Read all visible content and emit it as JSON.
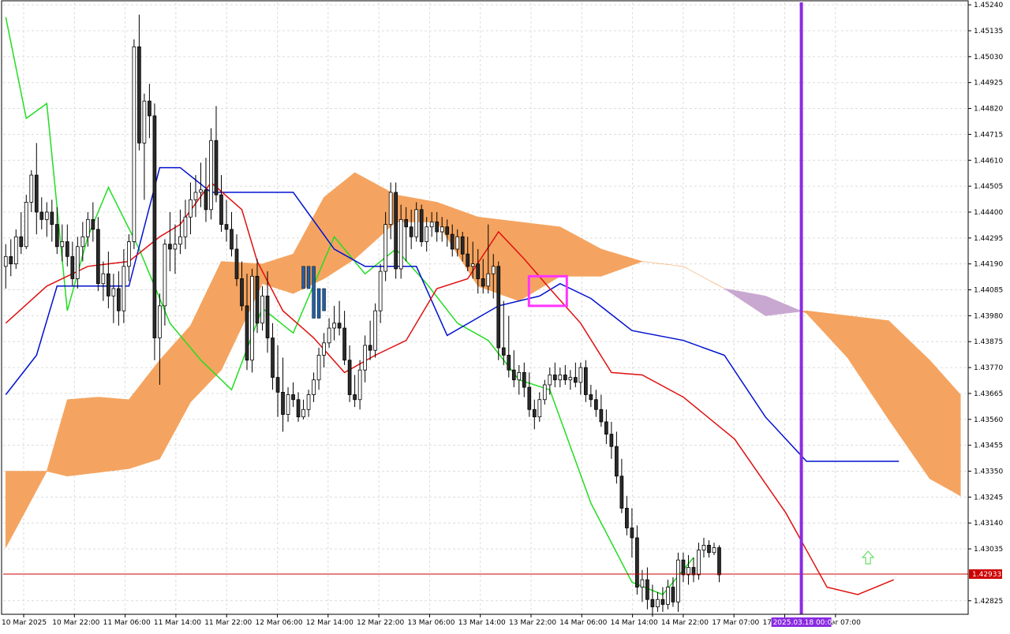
{
  "chart_data": {
    "type": "candlestick",
    "instrument_note": "",
    "y_ticks": [
      "1.45240",
      "1.45135",
      "1.45030",
      "1.44925",
      "1.44820",
      "1.44715",
      "1.44610",
      "1.44505",
      "1.44400",
      "1.44295",
      "1.44190",
      "1.44085",
      "1.43980",
      "1.43875",
      "1.43770",
      "1.43665",
      "1.43560",
      "1.43455",
      "1.43350",
      "1.43245",
      "1.43140",
      "1.43035",
      "1.42933",
      "1.42825"
    ],
    "y_tick_values": [
      1.4524,
      1.45135,
      1.4503,
      1.44925,
      1.4482,
      1.44715,
      1.4461,
      1.44505,
      1.444,
      1.44295,
      1.4419,
      1.44085,
      1.4398,
      1.43875,
      1.4377,
      1.43665,
      1.4356,
      1.43455,
      1.4335,
      1.43245,
      1.4314,
      1.43035,
      1.42825
    ],
    "ylim": [
      1.4277,
      1.4525
    ],
    "x_ticks": [
      "10 Mar 2025",
      "10 Mar 22:00",
      "11 Mar 06:00",
      "11 Mar 14:00",
      "11 Mar 22:00",
      "12 Mar 06:00",
      "12 Mar 14:00",
      "12 Mar 22:00",
      "13 Mar 06:00",
      "13 Mar 14:00",
      "13 Mar 22:00",
      "14 Mar 06:00",
      "14 Mar 14:00",
      "14 Mar 22:00",
      "17 Mar 07:00",
      "17 Mar 23:00",
      "18 Mar 07:00"
    ],
    "current_price": "1.42933",
    "current_price_value": 1.42933,
    "cursor_date_label": "2025.03.18 00:00",
    "grid": true,
    "colors": {
      "background": "#ffffff",
      "grid": "#dcdcdc",
      "candle_bull_fill": "#ffffff",
      "candle_bear_fill": "#2b2b2b",
      "candle_outline": "#000000",
      "candle_highlight": "#1f5fa8",
      "tenkan": "#e01010",
      "kijun": "#0010d0",
      "chikou": "#22dd22",
      "kumo_bull": "#f4a460",
      "kumo_bear": "#c8a8d0",
      "price_line": "#cc0000",
      "price_tag": "#cc0000",
      "vline": "#8a2be2",
      "date_tag": "#8a2be2",
      "highlight_box": "#ff33ff",
      "arrow": "#66dd66"
    },
    "candles_ohlc": [
      [
        1.4418,
        1.4427,
        1.4409,
        1.4422
      ],
      [
        1.4422,
        1.4429,
        1.4414,
        1.4419
      ],
      [
        1.4419,
        1.4433,
        1.4417,
        1.443
      ],
      [
        1.443,
        1.444,
        1.4423,
        1.4426
      ],
      [
        1.4426,
        1.4447,
        1.4425,
        1.4444
      ],
      [
        1.4444,
        1.4457,
        1.444,
        1.4455
      ],
      [
        1.4455,
        1.4468,
        1.4431,
        1.444
      ],
      [
        1.444,
        1.4446,
        1.4433,
        1.4437
      ],
      [
        1.4437,
        1.4444,
        1.443,
        1.444
      ],
      [
        1.444,
        1.4445,
        1.4428,
        1.4435
      ],
      [
        1.4435,
        1.4442,
        1.4423,
        1.4426
      ],
      [
        1.4426,
        1.4435,
        1.442,
        1.4428
      ],
      [
        1.4428,
        1.4435,
        1.4418,
        1.4422
      ],
      [
        1.4422,
        1.4428,
        1.441,
        1.4413
      ],
      [
        1.4413,
        1.443,
        1.4409,
        1.4426
      ],
      [
        1.4426,
        1.4436,
        1.442,
        1.443
      ],
      [
        1.443,
        1.444,
        1.4426,
        1.4437
      ],
      [
        1.4437,
        1.4444,
        1.4428,
        1.4433
      ],
      [
        1.4433,
        1.4438,
        1.4408,
        1.4411
      ],
      [
        1.4411,
        1.442,
        1.4404,
        1.4415
      ],
      [
        1.4415,
        1.4424,
        1.4401,
        1.4406
      ],
      [
        1.4406,
        1.4415,
        1.4395,
        1.4409
      ],
      [
        1.4409,
        1.4416,
        1.4394,
        1.44
      ],
      [
        1.44,
        1.4425,
        1.4395,
        1.4418
      ],
      [
        1.4418,
        1.4431,
        1.4412,
        1.4428
      ],
      [
        1.4428,
        1.451,
        1.4425,
        1.4507
      ],
      [
        1.4507,
        1.452,
        1.4465,
        1.4468
      ],
      [
        1.4468,
        1.4488,
        1.4445,
        1.4485
      ],
      [
        1.4485,
        1.4492,
        1.447,
        1.4479
      ],
      [
        1.4479,
        1.4484,
        1.438,
        1.4389
      ],
      [
        1.4389,
        1.4407,
        1.437,
        1.4402
      ],
      [
        1.4402,
        1.4429,
        1.4394,
        1.4427
      ],
      [
        1.4427,
        1.444,
        1.4416,
        1.4425
      ],
      [
        1.4425,
        1.4435,
        1.4415,
        1.4427
      ],
      [
        1.4427,
        1.4441,
        1.4423,
        1.443
      ],
      [
        1.443,
        1.4445,
        1.4425,
        1.4438
      ],
      [
        1.4438,
        1.4452,
        1.4431,
        1.4445
      ],
      [
        1.4445,
        1.4455,
        1.4438,
        1.4448
      ],
      [
        1.4448,
        1.446,
        1.4442,
        1.4449
      ],
      [
        1.4449,
        1.4462,
        1.4436,
        1.4441
      ],
      [
        1.4441,
        1.4474,
        1.4437,
        1.4469
      ],
      [
        1.4469,
        1.4483,
        1.4444,
        1.4447
      ],
      [
        1.4447,
        1.4455,
        1.4432,
        1.4435
      ],
      [
        1.4435,
        1.4445,
        1.4428,
        1.4433
      ],
      [
        1.4433,
        1.444,
        1.4422,
        1.4425
      ],
      [
        1.4425,
        1.4431,
        1.441,
        1.4413
      ],
      [
        1.4413,
        1.442,
        1.44,
        1.4402
      ],
      [
        1.4402,
        1.4415,
        1.4376,
        1.438
      ],
      [
        1.438,
        1.4417,
        1.4375,
        1.4414
      ],
      [
        1.4414,
        1.4421,
        1.4391,
        1.4395
      ],
      [
        1.4395,
        1.441,
        1.4392,
        1.4406
      ],
      [
        1.4406,
        1.4416,
        1.4383,
        1.4389
      ],
      [
        1.4389,
        1.4395,
        1.4368,
        1.4373
      ],
      [
        1.4373,
        1.4386,
        1.4357,
        1.4367
      ],
      [
        1.4367,
        1.4381,
        1.4351,
        1.4358
      ],
      [
        1.4358,
        1.4369,
        1.4355,
        1.4366
      ],
      [
        1.4366,
        1.4371,
        1.4361,
        1.4364
      ],
      [
        1.4364,
        1.4367,
        1.4355,
        1.4357
      ],
      [
        1.4357,
        1.4364,
        1.4356,
        1.436
      ],
      [
        1.436,
        1.4368,
        1.4357,
        1.4366
      ],
      [
        1.4366,
        1.4375,
        1.4363,
        1.4372
      ],
      [
        1.4372,
        1.4385,
        1.4368,
        1.4382
      ],
      [
        1.4382,
        1.4391,
        1.4377,
        1.4387
      ],
      [
        1.4387,
        1.4397,
        1.4385,
        1.4393
      ],
      [
        1.4393,
        1.4402,
        1.4388,
        1.4395
      ],
      [
        1.4395,
        1.4404,
        1.439,
        1.4393
      ],
      [
        1.4393,
        1.44,
        1.4378,
        1.438
      ],
      [
        1.438,
        1.4386,
        1.4363,
        1.4366
      ],
      [
        1.4366,
        1.4374,
        1.4361,
        1.4364
      ],
      [
        1.4364,
        1.438,
        1.436,
        1.4376
      ],
      [
        1.4376,
        1.439,
        1.4371,
        1.4386
      ],
      [
        1.4386,
        1.4396,
        1.438,
        1.4384
      ],
      [
        1.4384,
        1.4403,
        1.4381,
        1.44
      ],
      [
        1.44,
        1.4419,
        1.4395,
        1.4416
      ],
      [
        1.4416,
        1.444,
        1.4412,
        1.4435
      ],
      [
        1.4435,
        1.4452,
        1.4429,
        1.4448
      ],
      [
        1.4448,
        1.4452,
        1.4413,
        1.4417
      ],
      [
        1.4417,
        1.4443,
        1.4413,
        1.4437
      ],
      [
        1.4437,
        1.4442,
        1.442,
        1.4434
      ],
      [
        1.4434,
        1.4441,
        1.4425,
        1.443
      ],
      [
        1.443,
        1.4444,
        1.4428,
        1.4441
      ],
      [
        1.4441,
        1.4443,
        1.4426,
        1.4428
      ],
      [
        1.4428,
        1.4438,
        1.4424,
        1.4434
      ],
      [
        1.4434,
        1.444,
        1.443,
        1.4436
      ],
      [
        1.4436,
        1.444,
        1.4428,
        1.4432
      ],
      [
        1.4432,
        1.4438,
        1.4428,
        1.4434
      ],
      [
        1.4434,
        1.4437,
        1.4426,
        1.4431
      ],
      [
        1.4431,
        1.4435,
        1.4422,
        1.4425
      ],
      [
        1.4425,
        1.4433,
        1.4422,
        1.443
      ],
      [
        1.443,
        1.4432,
        1.442,
        1.4423
      ],
      [
        1.4423,
        1.443,
        1.4416,
        1.4418
      ],
      [
        1.4418,
        1.4428,
        1.4413,
        1.4419
      ],
      [
        1.4419,
        1.4425,
        1.4407,
        1.4413
      ],
      [
        1.4413,
        1.4421,
        1.4407,
        1.441
      ],
      [
        1.441,
        1.4435,
        1.4407,
        1.4415
      ],
      [
        1.4415,
        1.4423,
        1.4405,
        1.4418
      ],
      [
        1.4418,
        1.442,
        1.438,
        1.4385
      ],
      [
        1.4385,
        1.4404,
        1.4378,
        1.4382
      ],
      [
        1.4382,
        1.4398,
        1.4373,
        1.4376
      ],
      [
        1.4376,
        1.4384,
        1.4369,
        1.4372
      ],
      [
        1.4372,
        1.4378,
        1.4366,
        1.4375
      ],
      [
        1.4375,
        1.4379,
        1.4365,
        1.4369
      ],
      [
        1.4369,
        1.4375,
        1.4357,
        1.436
      ],
      [
        1.436,
        1.4364,
        1.4352,
        1.4357
      ],
      [
        1.4357,
        1.4367,
        1.4355,
        1.4364
      ],
      [
        1.4364,
        1.4372,
        1.4362,
        1.437
      ],
      [
        1.437,
        1.4377,
        1.4366,
        1.4374
      ],
      [
        1.4374,
        1.4379,
        1.4369,
        1.4372
      ],
      [
        1.4372,
        1.4377,
        1.4369,
        1.4374
      ],
      [
        1.4374,
        1.4378,
        1.437,
        1.4372
      ],
      [
        1.4372,
        1.4376,
        1.4368,
        1.4373
      ],
      [
        1.4373,
        1.4379,
        1.4369,
        1.4371
      ],
      [
        1.4371,
        1.4379,
        1.4366,
        1.4377
      ],
      [
        1.4377,
        1.438,
        1.4363,
        1.4366
      ],
      [
        1.4366,
        1.437,
        1.4361,
        1.4364
      ],
      [
        1.4364,
        1.4368,
        1.4357,
        1.436
      ],
      [
        1.436,
        1.4366,
        1.4353,
        1.4355
      ],
      [
        1.4355,
        1.436,
        1.4346,
        1.435
      ],
      [
        1.435,
        1.4355,
        1.434,
        1.4345
      ],
      [
        1.4345,
        1.4351,
        1.433,
        1.4333
      ],
      [
        1.4333,
        1.434,
        1.4318,
        1.432
      ],
      [
        1.432,
        1.4325,
        1.4309,
        1.4312
      ],
      [
        1.4312,
        1.432,
        1.43,
        1.4308
      ],
      [
        1.4308,
        1.4313,
        1.4285,
        1.4288
      ],
      [
        1.4288,
        1.4295,
        1.4282,
        1.4291
      ],
      [
        1.4291,
        1.4296,
        1.4279,
        1.4283
      ],
      [
        1.4283,
        1.4289,
        1.4276,
        1.428
      ],
      [
        1.428,
        1.4286,
        1.4278,
        1.4283
      ],
      [
        1.4283,
        1.4288,
        1.4278,
        1.4281
      ],
      [
        1.4281,
        1.4291,
        1.4279,
        1.4288
      ],
      [
        1.4288,
        1.4292,
        1.428,
        1.4282
      ],
      [
        1.4282,
        1.4302,
        1.4278,
        1.4299
      ],
      [
        1.4299,
        1.4302,
        1.429,
        1.4293
      ],
      [
        1.4293,
        1.4301,
        1.4289,
        1.4296
      ],
      [
        1.4296,
        1.43,
        1.429,
        1.4293
      ],
      [
        1.4293,
        1.4306,
        1.4291,
        1.4303
      ],
      [
        1.4303,
        1.4308,
        1.43,
        1.4305
      ],
      [
        1.4305,
        1.4307,
        1.43,
        1.4302
      ],
      [
        1.4302,
        1.4306,
        1.4301,
        1.4304
      ],
      [
        1.4304,
        1.4305,
        1.429,
        1.4293
      ]
    ],
    "highlight_candles": [
      [
        1.4418,
        1.4421,
        1.4406,
        1.4409
      ],
      [
        1.4409,
        1.4423,
        1.4401,
        1.4418
      ],
      [
        1.4418,
        1.442,
        1.4394,
        1.4397
      ],
      [
        1.4397,
        1.4412,
        1.4392,
        1.4409
      ],
      [
        1.4409,
        1.4412,
        1.4396,
        1.44
      ]
    ],
    "tenkan": [
      [
        0,
        1.4395
      ],
      [
        8,
        1.441
      ],
      [
        16,
        1.4418
      ],
      [
        24,
        1.442
      ],
      [
        30,
        1.443
      ],
      [
        34,
        1.4435
      ],
      [
        40,
        1.4452
      ],
      [
        46,
        1.4441
      ],
      [
        49,
        1.442
      ],
      [
        54,
        1.44
      ],
      [
        60,
        1.4389
      ],
      [
        66,
        1.4375
      ],
      [
        72,
        1.4382
      ],
      [
        78,
        1.4388
      ],
      [
        84,
        1.4409
      ],
      [
        90,
        1.4413
      ],
      [
        96,
        1.4432
      ],
      [
        101,
        1.4421
      ],
      [
        106,
        1.4409
      ],
      [
        112,
        1.4395
      ],
      [
        118,
        1.4375
      ],
      [
        124,
        1.4374
      ],
      [
        132,
        1.4365
      ],
      [
        142,
        1.4348
      ],
      [
        152,
        1.4318
      ],
      [
        160,
        1.4288
      ],
      [
        166,
        1.4285
      ],
      [
        173,
        1.4291
      ]
    ],
    "kijun": [
      [
        0,
        1.4366
      ],
      [
        6,
        1.4382
      ],
      [
        10,
        1.441
      ],
      [
        24,
        1.441
      ],
      [
        30,
        1.4458
      ],
      [
        34,
        1.4458
      ],
      [
        40,
        1.4448
      ],
      [
        56,
        1.4448
      ],
      [
        64,
        1.4425
      ],
      [
        70,
        1.4418
      ],
      [
        80,
        1.4418
      ],
      [
        86,
        1.439
      ],
      [
        96,
        1.4402
      ],
      [
        104,
        1.4406
      ],
      [
        108,
        1.4411
      ],
      [
        114,
        1.4405
      ],
      [
        122,
        1.4392
      ],
      [
        132,
        1.4388
      ],
      [
        140,
        1.4382
      ],
      [
        148,
        1.4357
      ],
      [
        156,
        1.4339
      ],
      [
        174,
        1.4339
      ]
    ],
    "chikou": [
      [
        0,
        1.4519
      ],
      [
        4,
        1.4478
      ],
      [
        8,
        1.4484
      ],
      [
        12,
        1.44
      ],
      [
        16,
        1.443
      ],
      [
        20,
        1.445
      ],
      [
        26,
        1.4425
      ],
      [
        32,
        1.4395
      ],
      [
        38,
        1.438
      ],
      [
        44,
        1.4368
      ],
      [
        50,
        1.4401
      ],
      [
        56,
        1.4391
      ],
      [
        64,
        1.443
      ],
      [
        70,
        1.4415
      ],
      [
        76,
        1.4425
      ],
      [
        82,
        1.4411
      ],
      [
        88,
        1.4395
      ],
      [
        94,
        1.4388
      ],
      [
        100,
        1.4372
      ],
      [
        106,
        1.4368
      ],
      [
        114,
        1.4322
      ],
      [
        122,
        1.429
      ],
      [
        128,
        1.4285
      ],
      [
        134,
        1.43
      ]
    ],
    "kumo": {
      "senkou_a": [
        [
          0,
          1.4335
        ],
        [
          8,
          1.4335
        ],
        [
          12,
          1.4364
        ],
        [
          18,
          1.4365
        ],
        [
          24,
          1.4364
        ],
        [
          30,
          1.438
        ],
        [
          36,
          1.4394
        ],
        [
          42,
          1.442
        ],
        [
          50,
          1.4419
        ],
        [
          56,
          1.4423
        ],
        [
          62,
          1.4446
        ],
        [
          68,
          1.4456
        ],
        [
          76,
          1.4447
        ],
        [
          84,
          1.4444
        ],
        [
          92,
          1.4438
        ],
        [
          100,
          1.4436
        ],
        [
          108,
          1.4434
        ],
        [
          116,
          1.4425
        ],
        [
          124,
          1.442
        ],
        [
          132,
          1.4418
        ],
        [
          140,
          1.4409
        ],
        [
          148,
          1.4398
        ],
        [
          156,
          1.44
        ],
        [
          164,
          1.4398
        ],
        [
          172,
          1.4396
        ],
        [
          180,
          1.438
        ],
        [
          186,
          1.4366
        ]
      ],
      "senkou_b": [
        [
          0,
          1.4304
        ],
        [
          8,
          1.4335
        ],
        [
          12,
          1.4333
        ],
        [
          24,
          1.4336
        ],
        [
          30,
          1.434
        ],
        [
          36,
          1.4363
        ],
        [
          42,
          1.4376
        ],
        [
          50,
          1.4411
        ],
        [
          56,
          1.4407
        ],
        [
          62,
          1.4413
        ],
        [
          68,
          1.4421
        ],
        [
          76,
          1.4436
        ],
        [
          84,
          1.4436
        ],
        [
          92,
          1.441
        ],
        [
          100,
          1.4404
        ],
        [
          108,
          1.4414
        ],
        [
          116,
          1.4414
        ],
        [
          124,
          1.442
        ],
        [
          132,
          1.4418
        ],
        [
          140,
          1.4409
        ],
        [
          148,
          1.4406
        ],
        [
          156,
          1.4399
        ],
        [
          164,
          1.4381
        ],
        [
          172,
          1.4356
        ],
        [
          180,
          1.4332
        ],
        [
          186,
          1.4325
        ]
      ]
    },
    "vline_index": 155,
    "highlight_box_range": [
      1.4402,
      1.4414
    ],
    "arrow_at_index": 168
  }
}
